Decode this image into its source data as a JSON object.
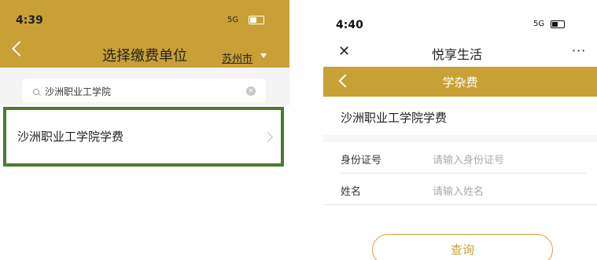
{
  "left": {
    "status": {
      "time": "4:39",
      "signal": "5G"
    },
    "header": {
      "title": "选择缴费单位",
      "city": "苏州市"
    },
    "search": {
      "value": "沙洲职业工学院"
    },
    "results": [
      {
        "label": "沙洲职业工学院学费"
      }
    ],
    "colors": {
      "header": "#c9a035",
      "highlight_border": "#4a7a2e"
    }
  },
  "right": {
    "status": {
      "time": "4:40",
      "signal": "5G"
    },
    "app_title": "悦享生活",
    "more": "···",
    "bar_title": "学杂费",
    "school": "沙洲职业工学院学费",
    "fields": [
      {
        "label": "身份证号",
        "placeholder": "请输入身份证号"
      },
      {
        "label": "姓名",
        "placeholder": "请输入姓名"
      }
    ],
    "query_label": "查询",
    "colors": {
      "bar": "#c9a035"
    }
  }
}
